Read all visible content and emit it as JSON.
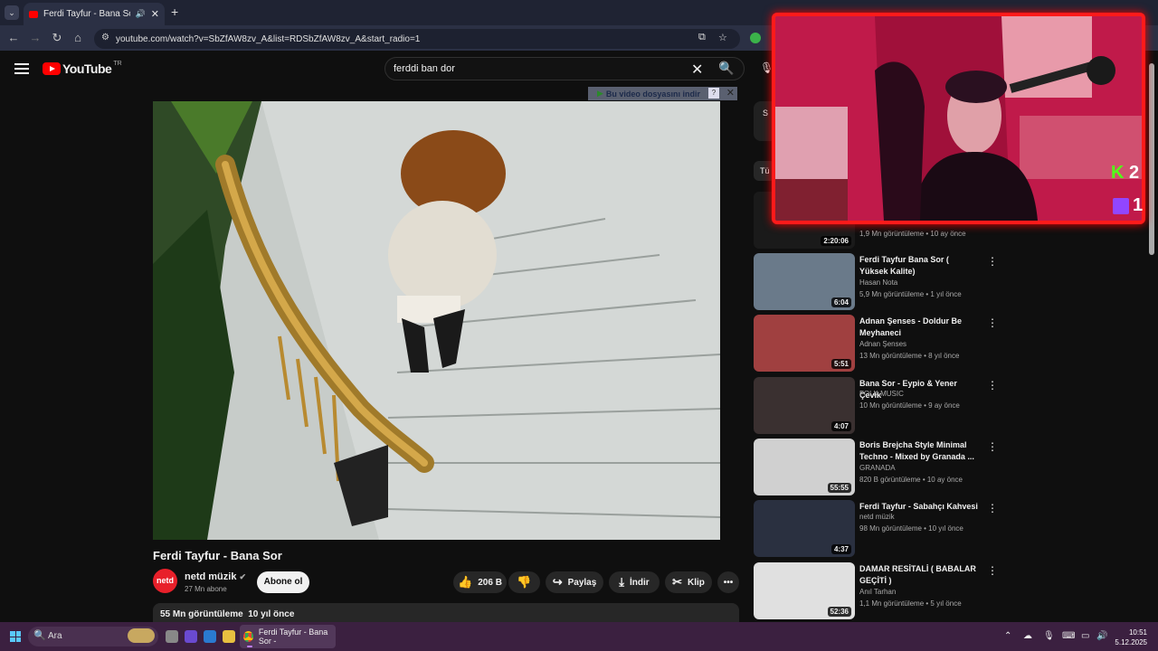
{
  "browser": {
    "tab_title": "Ferdi Tayfur - Bana Sor - Yo",
    "url": "youtube.com/watch?v=SbZfAW8zv_A&list=RDSbZfAW8zv_A&start_radio=1"
  },
  "youtube": {
    "logo_text": "YouTube",
    "country_code": "TR",
    "search_query": "ferddi ban dor",
    "download_bar": "Bu video dosyasını indir",
    "download_bar_help": "?",
    "video": {
      "title": "Ferdi Tayfur - Bana Sor",
      "channel": "netd müzik",
      "channel_avatar": "netd",
      "subscribers": "27 Mn abone",
      "subscribe_label": "Abone ol",
      "likes": "206 B",
      "share_label": "Paylaş",
      "download_label": "İndir",
      "clip_label": "Klip",
      "views": "55 Mn görüntüleme",
      "age": "10 yıl önce"
    },
    "sidebar": {
      "partial_chip": "Tü",
      "partial_top": "S",
      "first_meta": "1,9 Mn görüntüleme • 10 ay önce",
      "first_duration": "2:20:06",
      "items": [
        {
          "title": "Ferdi Tayfur Bana Sor ( Yüksek Kalite)",
          "channel": "Hasan Nota",
          "meta": "5,9 Mn görüntüleme • 1 yıl önce",
          "duration": "6:04",
          "color": "#6a7a8a"
        },
        {
          "title": "Adnan Şenses - Doldur Be Meyhaneci",
          "channel": "Adnan Şenses",
          "meta": "13 Mn görüntüleme • 8 yıl önce",
          "duration": "5:51",
          "color": "#a04040"
        },
        {
          "title": "Bana Sor - Eypio & Yener Çevik",
          "channel": "FOLK MUSIC",
          "meta": "10 Mn görüntüleme • 9 ay önce",
          "duration": "4:07",
          "color": "#3a3030"
        },
        {
          "title": "Boris Brejcha Style Minimal Techno - Mixed by Granada ...",
          "channel": "GRANADA",
          "meta": "820 B görüntüleme • 10 ay önce",
          "duration": "55:55",
          "color": "#d0d0d0"
        },
        {
          "title": "Ferdi Tayfur - Sabahçı Kahvesi",
          "channel": "netd müzik",
          "meta": "98 Mn görüntüleme • 10 yıl önce",
          "duration": "4:37",
          "color": "#2a3040"
        },
        {
          "title": "DAMAR RESİTALİ ( BABALAR GEÇİTİ )",
          "channel": "Anıl Tarhan",
          "meta": "1,1 Mn görüntüleme • 5 yıl önce",
          "duration": "52:36",
          "color": "#e0e0e0"
        }
      ]
    }
  },
  "overlay": {
    "kick_count": "2",
    "twitch_count": "1",
    "kick_letter": "K"
  },
  "taskbar": {
    "search_placeholder": "Ara",
    "chrome_label": "Ferdi Tayfur - Bana Sor -",
    "time": "10:51",
    "date": "5.12.2025"
  }
}
